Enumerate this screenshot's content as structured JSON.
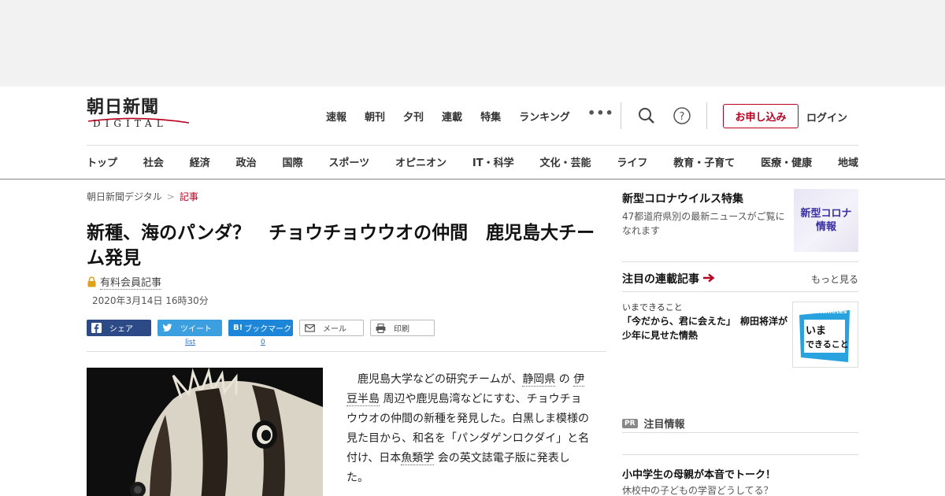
{
  "logo": {
    "main": "朝日新聞",
    "sub": "DIGITAL"
  },
  "topnav": [
    "速報",
    "朝刊",
    "夕刊",
    "連載",
    "特集",
    "ランキング"
  ],
  "more_dots": "•••",
  "apply_label": "お申し込み",
  "login_label": "ログイン",
  "categories": [
    "トップ",
    "社会",
    "経済",
    "政治",
    "国際",
    "スポーツ",
    "オピニオン",
    "IT・科学",
    "文化・芸能",
    "ライフ",
    "教育・子育て",
    "医療・健康",
    "地域"
  ],
  "breadcrumb": {
    "home": "朝日新聞デジタル",
    "sep": ">",
    "current": "記事"
  },
  "article": {
    "title": "新種、海のパンダ？　チョウチョウウオの仲間　鹿児島大チーム発見",
    "paid_label": "有料会員記事",
    "date": "2020年3月14日 16時30分",
    "share": {
      "facebook": "シェア",
      "twitter": "ツイート",
      "hatena": "ブックマーク",
      "hatena_prefix": "B!",
      "mail": "メール",
      "print": "印刷"
    },
    "twitter_count": "list",
    "hatena_count": "0",
    "body": {
      "p1": "鹿児島大学などの研究チームが、",
      "link1": "静岡県",
      "p2": "の",
      "link2": "伊豆半島",
      "p3": "周辺や鹿児島湾などにすむ、チョウチョウウオの仲間の新種を発見した。白黒しま模様の見た目から、和名を「パンダゲンロクダイ」と名付け、日本",
      "link3": "魚類学",
      "p4": "会の英文誌電子版に発表した。"
    }
  },
  "sidebar": {
    "corona": {
      "title": "新型コロナウイルス特集",
      "text": "47都道府県別の最新ニュースがご覧になれます",
      "image_text_1": "新型コロナ",
      "image_text_2": "情報"
    },
    "rensai": {
      "title": "注目の連載記事",
      "more": "もっと見る",
      "category": "いまできること",
      "item": "「今だから、君に会えた」　柳田将洋が少年に見せた情熱",
      "img_top": "The Athletes",
      "img_l1": "いま",
      "img_l2": "できること"
    },
    "pr": {
      "tag": "PR",
      "label": "注目情報",
      "title": "小中学生の母親が本音でトーク！",
      "sub": "休校中の子どもの学習どうしてる？"
    }
  },
  "colors": {
    "brand_red": "#b8001f",
    "facebook": "#2c4a86",
    "twitter": "#3b9fe0",
    "hatena": "#1e86d8",
    "corona_purple": "#3a2fa0",
    "athletes_blue": "#29a3e0"
  },
  "icons": [
    "search-icon",
    "help-icon",
    "lock-icon",
    "facebook-icon",
    "twitter-icon",
    "hatena-icon",
    "mail-icon",
    "print-icon",
    "arrow-right-icon"
  ]
}
